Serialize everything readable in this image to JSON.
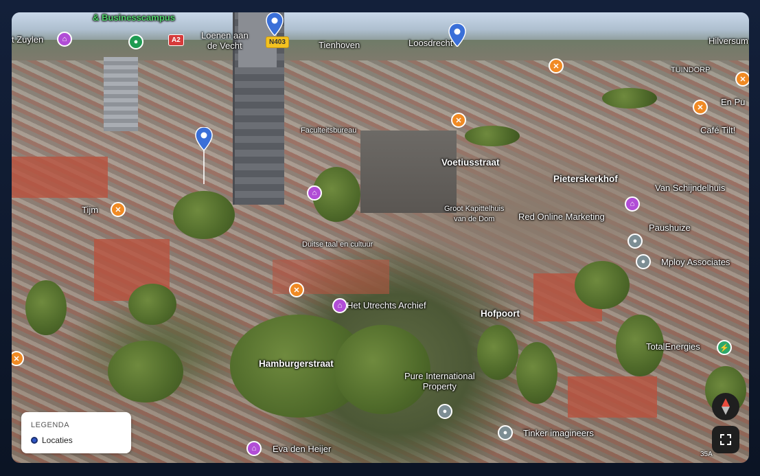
{
  "map": {
    "place_labels": [
      {
        "id": "businesscampus",
        "text": "& Businesscampus",
        "style": "green"
      },
      {
        "id": "zuylen",
        "text": "t Zuylen",
        "style": ""
      },
      {
        "id": "loenen",
        "text": "Loenen aan\nde Vecht",
        "style": ""
      },
      {
        "id": "tienhoven",
        "text": "Tienhoven",
        "style": ""
      },
      {
        "id": "loosdrecht",
        "text": "Loosdrecht",
        "style": ""
      },
      {
        "id": "hilversum",
        "text": "Hilversum",
        "style": ""
      },
      {
        "id": "tuindorp",
        "text": "TUINDORP",
        "style": "small"
      },
      {
        "id": "enpu",
        "text": "En Pu",
        "style": ""
      },
      {
        "id": "cafetilt",
        "text": "Café Tilt!",
        "style": ""
      },
      {
        "id": "faculteitsbureau",
        "text": "Faculteitsbureau",
        "style": "small"
      },
      {
        "id": "voetiusstraat",
        "text": "Voetiusstraat",
        "style": "bold"
      },
      {
        "id": "pieterskerkhof",
        "text": "Pieterskerkhof",
        "style": "bold"
      },
      {
        "id": "vanschijndel",
        "text": "Van Schijndelhuis",
        "style": ""
      },
      {
        "id": "tijm",
        "text": "Tijm",
        "style": ""
      },
      {
        "id": "groot",
        "text": "Groot Kapittelhuis\nvan de Dom",
        "style": "small"
      },
      {
        "id": "redonline",
        "text": "Red Online Marketing",
        "style": ""
      },
      {
        "id": "paushuize",
        "text": "Paushuize",
        "style": ""
      },
      {
        "id": "duitse",
        "text": "Duitse taal en cultuur",
        "style": "small"
      },
      {
        "id": "mploy",
        "text": "Mploy Associates",
        "style": ""
      },
      {
        "id": "archief",
        "text": "Het Utrechts Archief",
        "style": ""
      },
      {
        "id": "hofpoort",
        "text": "Hofpoort",
        "style": "bold"
      },
      {
        "id": "hamburger",
        "text": "Hamburgerstraat",
        "style": "bold"
      },
      {
        "id": "pure",
        "text": "Pure International\nProperty",
        "style": ""
      },
      {
        "id": "totalenergies",
        "text": "TotalEnergies",
        "style": ""
      },
      {
        "id": "tinker",
        "text": "Tinker imagineers",
        "style": ""
      },
      {
        "id": "evaden",
        "text": "Eva den Heijer",
        "style": ""
      }
    ],
    "road_shields": [
      {
        "id": "a2",
        "text": "A2",
        "color": "#d63a3a"
      },
      {
        "id": "n403",
        "text": "N403",
        "color": "#f4c21f"
      }
    ],
    "road_number": "35A"
  },
  "legend": {
    "title": "LEGENDA",
    "item_label": "Locaties",
    "item_color": "#2f56c6"
  },
  "controls": {
    "compass_icon": "compass-icon",
    "fullscreen_icon": "fullscreen-icon"
  },
  "colors": {
    "pin_blue": "#3a6fd8",
    "poi_food": "#f08a24",
    "poi_culture": "#b14dd6",
    "poi_business": "#7d8e94"
  }
}
